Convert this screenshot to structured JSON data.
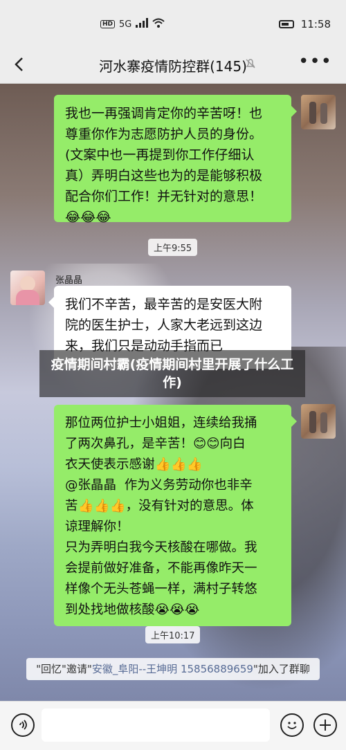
{
  "status_bar": {
    "network": "HD",
    "signal": "5G",
    "time": "11:58"
  },
  "header": {
    "back_icon": "chevron-left-icon",
    "title": "河水寨疫情防控群(145)",
    "mute_icon": "bell-muted-icon",
    "more": "•••"
  },
  "messages": [
    {
      "type": "outgoing",
      "text": "我也一再强调肯定你的辛苦呀！也\n尊重你作为志愿防护人员的身份。\n(文案中也一再提到你工作仔细认\n真）弄明白这些也为的是能够积极\n配合你们工作！并无针对的意思！\n😂😂😂"
    },
    {
      "type": "time",
      "text": "上午9:55"
    },
    {
      "type": "incoming",
      "sender": "张晶晶",
      "text": "我们不辛苦，最辛苦的是安医大附\n院的医生护士，人家大老远到这边\n来，我们只是动动手指而已"
    },
    {
      "type": "outgoing",
      "text": "那位两位护士小姐姐，连续给我捅\n了两次鼻孔，是辛苦！😊😊向白\n衣天使表示感谢👍👍👍\n@张晶晶  作为义务劳动你也非辛\n苦👍👍👍，没有针对的意思。体\n谅理解你！\n只为弄明白我今天核酸在哪做。我\n会提前做好准备，不能再像昨天一\n样像个无头苍蝇一样，满村子转悠\n到处找地做核酸😭😭😭"
    },
    {
      "type": "time",
      "text": "上午10:17"
    }
  ],
  "system_notice": {
    "part1": "\"回忆\"",
    "part2": "邀请\"",
    "part3": "安徽_阜阳--王坤明 15856889659",
    "part4": "\"加入了群聊"
  },
  "overlay_caption": "疫情期间村霸(疫情期间村里开展了什么工作)",
  "input_bar": {
    "voice_icon": "voice-icon",
    "emoji_icon": "emoji-icon",
    "plus_icon": "plus-icon"
  }
}
